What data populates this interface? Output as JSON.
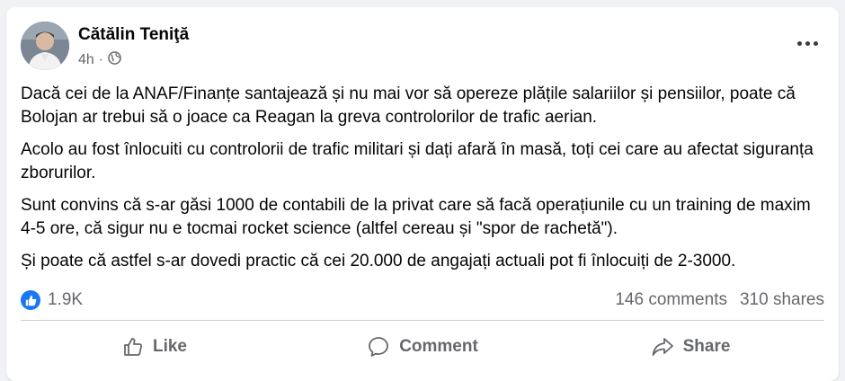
{
  "post": {
    "author": "Cătălin Teniţă",
    "time": "4h",
    "privacy_icon": "globe-icon",
    "menu_icon": "more-options-icon",
    "paragraphs": [
      "Dacă cei de la ANAF/Finanțe santajează și nu mai vor să opereze plățile salariilor și pensiilor, poate că Bolojan ar trebui să o joace ca Reagan la greva controlorilor de trafic aerian.",
      "Acolo au fost înlocuiti cu controlorii de trafic militari și dați afară în masă, toți cei care au afectat siguranța zborurilor.",
      "Sunt convins că s-ar găsi 1000 de contabili de la privat care să facă operațiunile cu un training de maxim 4-5 ore, că sigur nu e tocmai rocket science (altfel cereau și \"spor de rachetă\").",
      "Și poate că astfel s-ar dovedi practic că cei 20.000 de angajați actuali pot fi înlocuiți de 2-3000."
    ]
  },
  "stats": {
    "reactions": "1.9K",
    "comments": "146 comments",
    "shares": "310 shares"
  },
  "actions": {
    "like": "Like",
    "comment": "Comment",
    "share": "Share"
  },
  "colors": {
    "accent": "#1877f2",
    "secondary_text": "#65676b",
    "primary_text": "#050505"
  }
}
